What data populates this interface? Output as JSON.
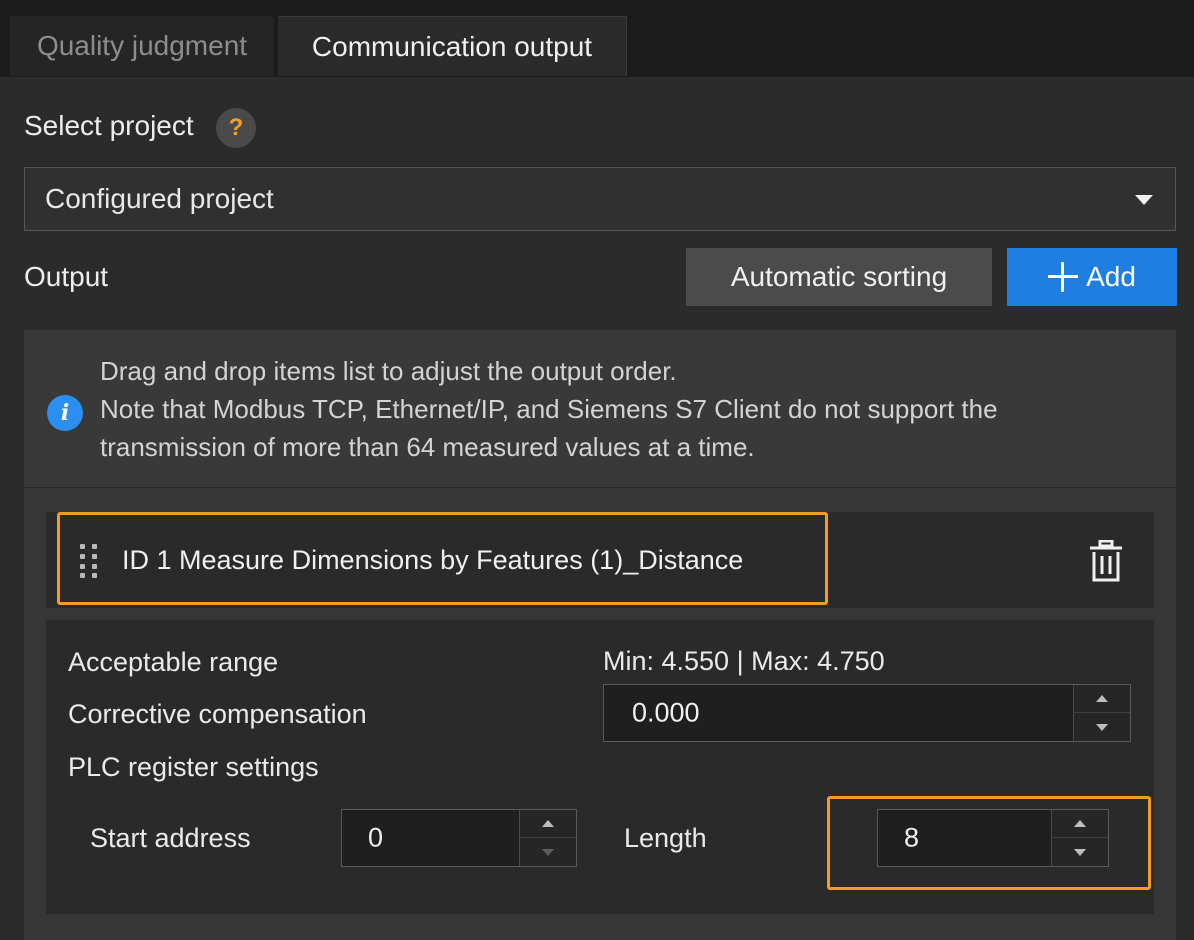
{
  "tabs": [
    {
      "label": "Quality judgment",
      "active": false
    },
    {
      "label": "Communication output",
      "active": true
    }
  ],
  "select_project": {
    "label": "Select project",
    "help_icon": "question-icon",
    "value": "Configured project"
  },
  "output": {
    "label": "Output",
    "auto_sort_label": "Automatic sorting",
    "add_label": "Add"
  },
  "notice": {
    "icon": "info-icon",
    "lines": [
      "Drag and drop items list to adjust the output order.",
      "Note that Modbus TCP, Ethernet/IP, and Siemens S7 Client do not support the",
      "transmission of more than 64 measured values at a time."
    ]
  },
  "item": {
    "title": "ID 1  Measure Dimensions by Features (1)_Distance",
    "acceptable_range_label": "Acceptable range",
    "acceptable_range_value": "Min: 4.550 | Max: 4.750",
    "corrective_compensation_label": "Corrective compensation",
    "corrective_compensation_value": "0.000",
    "plc_label": "PLC register settings",
    "start_address_label": "Start address",
    "start_address_value": "0",
    "length_label": "Length",
    "length_value": "8"
  },
  "colors": {
    "accent": "#1f7fe0",
    "highlight": "#f39c1f",
    "help": "#f0a02a"
  }
}
